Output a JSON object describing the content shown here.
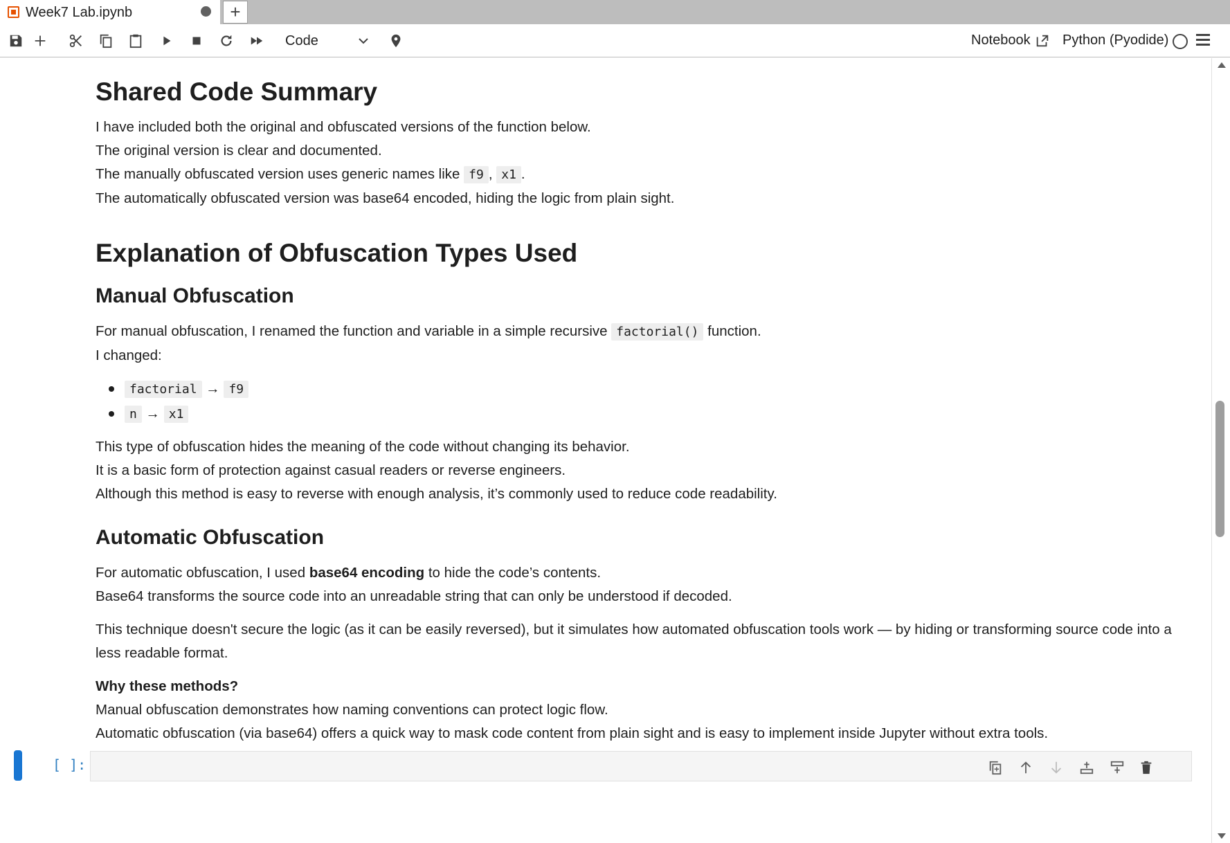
{
  "tab": {
    "title": "Week7 Lab.ipynb",
    "new_tab_symbol": "+"
  },
  "toolbar": {
    "buttons": [
      "save-icon",
      "add-cell-icon",
      "cut-icon",
      "copy-icon",
      "paste-icon",
      "run-icon",
      "stop-icon",
      "restart-icon",
      "run-all-icon"
    ],
    "cell_type": "Code",
    "notebook_link": "Notebook",
    "kernel": "Python (Pyodide)"
  },
  "content": {
    "h_shared": "Shared Code Summary",
    "shared_p1": "I have included both the original and obfuscated versions of the function below.",
    "shared_p2": "The original version is clear and documented.",
    "shared_p3_pre": "The manually obfuscated version uses generic names like ",
    "shared_p3_code1": "f9",
    "shared_p3_sep": ", ",
    "shared_p3_code2": "x1",
    "shared_p3_post": ".",
    "shared_p4": "The automatically obfuscated version was base64 encoded, hiding the logic from plain sight.",
    "h_explanation": "Explanation of Obfuscation Types Used",
    "h_manual": "Manual Obfuscation",
    "manual_p1_pre": "For manual obfuscation, I renamed the function and variable in a simple recursive ",
    "manual_p1_code": "factorial()",
    "manual_p1_post": " function.",
    "manual_p2": "I changed:",
    "changes": [
      {
        "from": "factorial",
        "arrow": " → ",
        "to": "f9"
      },
      {
        "from": "n",
        "arrow": " → ",
        "to": "x1"
      }
    ],
    "manual_p3": "This type of obfuscation hides the meaning of the code without changing its behavior.",
    "manual_p4": "It is a basic form of protection against casual readers or reverse engineers.",
    "manual_p5": "Although this method is easy to reverse with enough analysis, it’s commonly used to reduce code readability.",
    "h_automatic": "Automatic Obfuscation",
    "auto_p1_pre": "For automatic obfuscation, I used ",
    "auto_p1_bold": "base64 encoding",
    "auto_p1_post": " to hide the code’s contents.",
    "auto_p2": "Base64 transforms the source code into an unreadable string that can only be understood if decoded.",
    "auto_p3": "This technique doesn't secure the logic (as it can be easily reversed), but it simulates how automated obfuscation tools work — by hiding or transforming source code into a less readable format.",
    "why_heading": "Why these methods?",
    "why_p1": "Manual obfuscation demonstrates how naming conventions can protect logic flow.",
    "why_p2": "Automatic obfuscation (via base64) offers a quick way to mask code content from plain sight and is easy to implement inside Jupyter without extra tools."
  },
  "cell": {
    "prompt": "[ ]:",
    "tools": [
      "duplicate-icon",
      "move-up-icon",
      "move-down-icon",
      "insert-above-icon",
      "insert-below-icon",
      "delete-icon"
    ]
  },
  "scrollbar": {
    "position_fraction": 0.53,
    "visible_fraction": 0.18
  },
  "colors": {
    "accent": "#1976d2",
    "prompt": "#307fc1",
    "tab_icon": "#e65100"
  }
}
